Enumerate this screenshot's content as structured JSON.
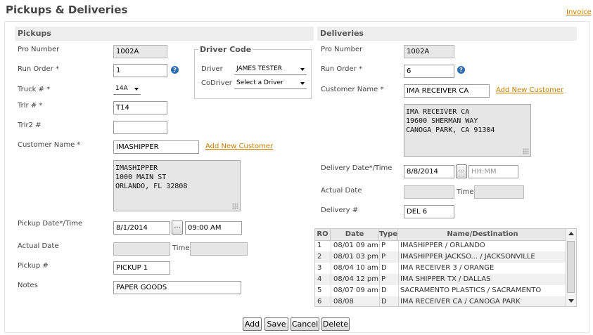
{
  "page": {
    "title": "Pickups & Deliveries",
    "invoice_link": "Invoice"
  },
  "pickups": {
    "section_title": "Pickups",
    "pro_number": {
      "label": "Pro Number",
      "value": "1002A"
    },
    "run_order": {
      "label": "Run Order *",
      "value": "1",
      "help": "?"
    },
    "truck": {
      "label": "Truck # *",
      "value": "14A"
    },
    "trlr": {
      "label": "Trlr # *",
      "value": "T14"
    },
    "trlr2": {
      "label": "Trlr2 #",
      "value": ""
    },
    "customer_name": {
      "label": "Customer Name *",
      "value": "IMASHIPPER",
      "add_link": "Add New Customer"
    },
    "address": "IMASHIPPER\n1000 MAIN ST\nORLANDO, FL 32808",
    "pickup_datetime": {
      "label": "Pickup Date*/Time",
      "date": "8/1/2014",
      "time": "09:00 AM",
      "picker": "..."
    },
    "actual_date": {
      "label": "Actual Date",
      "value": "",
      "time_label": "Time",
      "time_value": ""
    },
    "pickup_number": {
      "label": "Pickup #",
      "value": "PICKUP 1"
    },
    "notes": {
      "label": "Notes",
      "value": "PAPER GOODS"
    }
  },
  "driver_code": {
    "legend": "Driver Code",
    "driver": {
      "label": "Driver",
      "value": "JAMES TESTER"
    },
    "codriver": {
      "label": "CoDriver",
      "value": "Select a Driver"
    }
  },
  "deliveries": {
    "section_title": "Deliveries",
    "pro_number": {
      "label": "Pro Number",
      "value": "1002A"
    },
    "run_order": {
      "label": "Run Order *",
      "value": "6",
      "help": "?"
    },
    "customer_name": {
      "label": "Customer Name *",
      "value": "IMA RECEIVER CA",
      "add_link": "Add New Customer"
    },
    "address": "IMA RECEIVER CA\n19600 SHERMAN WAY\nCANOGA PARK, CA 91304",
    "delivery_datetime": {
      "label": "Delivery Date*/Time",
      "date": "8/8/2014",
      "time_placeholder": "HH:MM",
      "picker": "..."
    },
    "actual_date": {
      "label": "Actual Date",
      "value": "",
      "time_label": "Time",
      "time_value": ""
    },
    "delivery_number": {
      "label": "Delivery #",
      "value": "DEL 6"
    }
  },
  "stops_table": {
    "columns": [
      "RO",
      "Date",
      "Type",
      "Name/Destination"
    ],
    "rows": [
      [
        "1",
        "08/01 09 am",
        "P",
        "IMASHIPPER / ORLANDO"
      ],
      [
        "2",
        "08/01 03 pm",
        "P",
        "IMASHIPPER JACKSO... / JACKSONVILLE"
      ],
      [
        "3",
        "08/04 10 am",
        "D",
        "IMA RECEIVER 3 / ORANGE"
      ],
      [
        "4",
        "08/04 12 pm",
        "P",
        "IMA SHIPPER TX / DALLAS"
      ],
      [
        "5",
        "08/07 09 am",
        "D",
        "SACRAMENTO PLASTICS / SACRAMENTO"
      ],
      [
        "6",
        "08/08",
        "D",
        "IMA RECEIVER CA / CANOGA PARK"
      ]
    ]
  },
  "actions": {
    "add": "Add",
    "save": "Save",
    "cancel": "Cancel",
    "delete": "Delete"
  }
}
